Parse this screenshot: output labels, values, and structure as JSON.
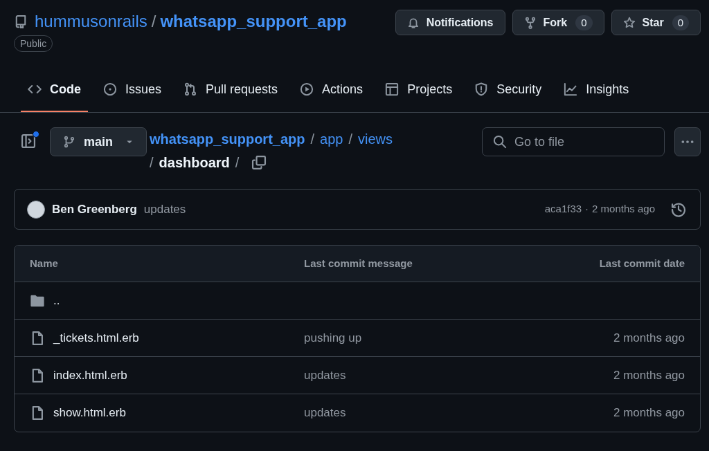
{
  "repo": {
    "owner": "hummusonrails",
    "separator": "/",
    "name": "whatsapp_support_app",
    "visibility": "Public"
  },
  "header_buttons": [
    {
      "label": "Notifications"
    },
    {
      "label": "Fork",
      "count": "0"
    },
    {
      "label": "Star",
      "count": "0"
    }
  ],
  "tabs": [
    {
      "label": "Code",
      "selected": true
    },
    {
      "label": "Issues",
      "selected": false
    },
    {
      "label": "Pull requests",
      "selected": false
    },
    {
      "label": "Actions",
      "selected": false
    },
    {
      "label": "Projects",
      "selected": false
    },
    {
      "label": "Security",
      "selected": false
    },
    {
      "label": "Insights",
      "selected": false
    }
  ],
  "branch": "main",
  "breadcrumb": {
    "links": [
      "whatsapp_support_app",
      "app",
      "views"
    ],
    "current": "dashboard",
    "separator": "/"
  },
  "search": {
    "placeholder": "Go to file"
  },
  "commit": {
    "author": "Ben Greenberg",
    "message": "updates",
    "sha": "aca1f33",
    "separator": "·",
    "time": "2 months ago"
  },
  "table": {
    "columns": [
      "Name",
      "Last commit message",
      "Last commit date"
    ],
    "rows": [
      {
        "kind": "folder",
        "name": ".."
      },
      {
        "kind": "file",
        "name": "_tickets.html.erb",
        "message": "pushing up",
        "date": "2 months ago"
      },
      {
        "kind": "file",
        "name": "index.html.erb",
        "message": "updates",
        "date": "2 months ago"
      },
      {
        "kind": "file",
        "name": "show.html.erb",
        "message": "updates",
        "date": "2 months ago"
      }
    ]
  }
}
